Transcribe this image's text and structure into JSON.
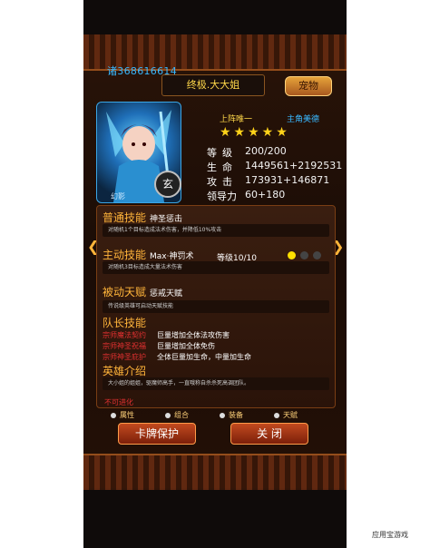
{
  "user_id": "诸368616614",
  "title": "终极.大大姐",
  "pet_button": "宠物",
  "tags": {
    "left": "上阵唯一",
    "right": "主角美德"
  },
  "stars": "★★★★★",
  "hero_tag": "幻影",
  "badge": "玄",
  "stats": [
    {
      "label": "等级",
      "value": "200/200"
    },
    {
      "label": "生命",
      "value": "1449561+2192531"
    },
    {
      "label": "攻击",
      "value": "173931+146871"
    },
    {
      "label": "领导力",
      "value": "60+180"
    }
  ],
  "normal_skill": {
    "title": "普通技能",
    "name": "神圣惩击",
    "desc": "对随机1个目标造成法术伤害，并降低10%攻击"
  },
  "active_skill": {
    "title": "主动技能",
    "name": "Max·神罚术",
    "level": "等级10/10",
    "desc": "对随机3目标造成大量法术伤害"
  },
  "passive": {
    "title": "被动天赋",
    "name": "惩戒天赋",
    "desc": "传说级英雄可启动天赋技能"
  },
  "team_skill": {
    "title": "队长技能",
    "items": [
      {
        "name": "宗师魔法契约",
        "effect": "巨量增加全体法攻伤害"
      },
      {
        "name": "宗师神圣祝福",
        "effect": "巨量增加全体免伤"
      },
      {
        "name": "宗师神圣庇护",
        "effect": "全体巨量加生命，中量加生命"
      }
    ]
  },
  "intro": {
    "title": "英雄介绍",
    "desc": "大小姐的姐姐，驱魔师高手，一直哦称自杀杀死高调团队。"
  },
  "evolve": "不可进化",
  "tabs": [
    "属性",
    "组合",
    "装备",
    "天赋"
  ],
  "buttons": {
    "protect": "卡牌保护",
    "close": "关 闭"
  },
  "watermark": "应用宝游戏"
}
